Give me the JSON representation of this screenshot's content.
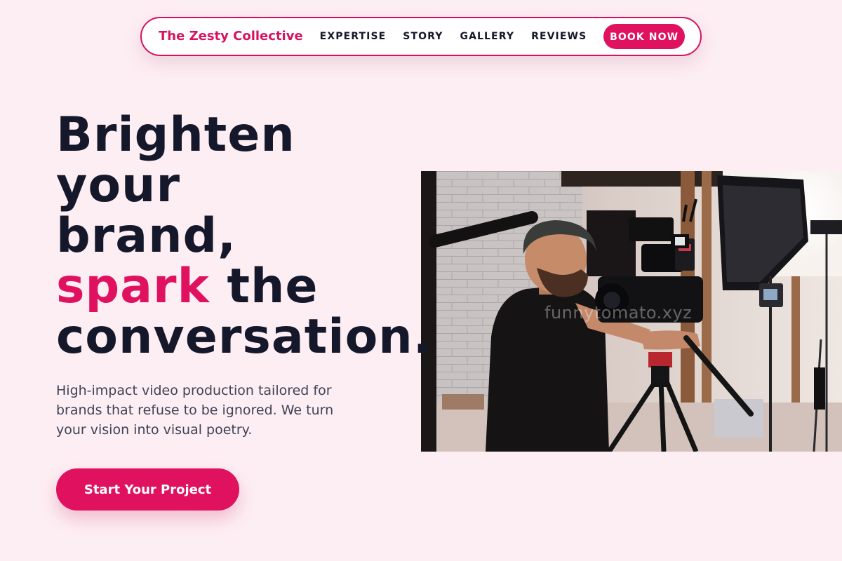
{
  "nav": {
    "brand": "The Zesty Collective",
    "links": [
      "EXPERTISE",
      "STORY",
      "GALLERY",
      "REVIEWS"
    ],
    "cta": "BOOK NOW"
  },
  "hero": {
    "headline": {
      "line1": "Brighten",
      "line2": "your",
      "line3": "brand,",
      "accent": "spark",
      "line4_rest": " the",
      "line5": "conversation."
    },
    "subtitle": "High-impact video production tailored for brands that refuse to be ignored. We turn your vision into visual poetry.",
    "cta": "Start Your Project"
  },
  "photo": {
    "watermark": "funnytomato.xyz"
  },
  "colors": {
    "background": "#fdeef3",
    "accent": "#e0115f",
    "text": "#15182a",
    "muted": "#3e4356"
  }
}
